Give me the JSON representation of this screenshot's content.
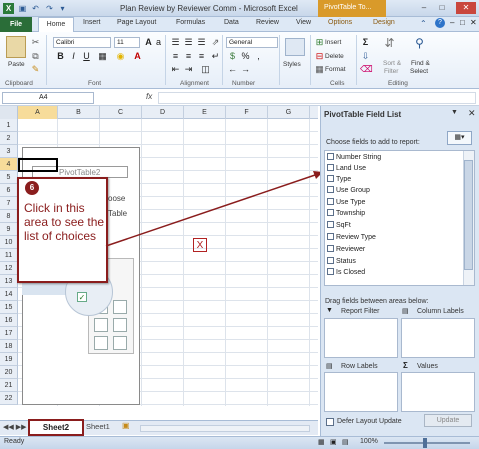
{
  "window": {
    "title": "Plan Review by Reviewer Comm  -  Microsoft Excel",
    "context_tab_title": "PivotTable To...",
    "file_tab": "File",
    "tabs": [
      "Home",
      "Insert",
      "Page Layout",
      "Formulas",
      "Data",
      "Review",
      "View",
      "Options",
      "Design"
    ]
  },
  "ribbon": {
    "clipboard": {
      "paste": "Paste",
      "label": "Clipboard"
    },
    "font": {
      "name": "Calibri",
      "size": "11",
      "label": "Font"
    },
    "alignment": {
      "label": "Alignment"
    },
    "number": {
      "format": "General",
      "label": "Number"
    },
    "styles": {
      "styles_button": "Styles"
    },
    "cells": {
      "insert": "Insert",
      "delete": "Delete",
      "format": "Format",
      "label": "Cells"
    },
    "editing": {
      "sort_filter": "Sort &",
      "sort_filter2": "Filter",
      "find_select": "Find &",
      "find_select2": "Select",
      "label": "Editing"
    }
  },
  "formula_bar": {
    "name_box": "A4",
    "fx": "fx",
    "formula": ""
  },
  "grid": {
    "columns": [
      "A",
      "B",
      "C",
      "D",
      "E",
      "F",
      "G"
    ],
    "rows": [
      "1",
      "2",
      "3",
      "4",
      "5",
      "6",
      "7",
      "8",
      "9",
      "10",
      "11",
      "12",
      "13",
      "14",
      "15",
      "16",
      "17",
      "18",
      "19",
      "20",
      "21",
      "22"
    ],
    "pivot_name": "PivotTable2",
    "choose_line1": "oose",
    "choose_line2": "Table"
  },
  "callout": {
    "number": "6",
    "text": "Click in this area to see the list of choices"
  },
  "marker": "X",
  "sheet_tabs": {
    "active": "Sheet2",
    "other": "Sheet1"
  },
  "status": {
    "ready": "Ready",
    "zoom": "100%"
  },
  "pivot_pane": {
    "title": "PivotTable Field List",
    "choose_label": "Choose fields to add to report:",
    "fields": [
      "Number String",
      "Land Use",
      "Type",
      "Use Group",
      "Use Type",
      "Township",
      "SqFt",
      "Review Type",
      "Reviewer",
      "Status",
      "Is Closed"
    ],
    "drag_label": "Drag fields between areas below:",
    "zones": {
      "report_filter": "Report Filter",
      "column_labels": "Column Labels",
      "row_labels": "Row Labels",
      "values": "Values"
    },
    "defer_label": "Defer Layout Update",
    "update_button": "Update"
  }
}
